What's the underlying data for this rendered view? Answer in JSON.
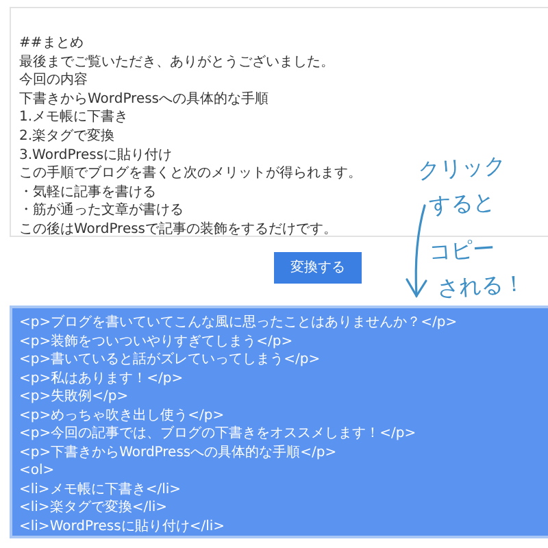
{
  "input": {
    "lines": [
      "##まとめ",
      "最後までご覧いただき、ありがとうございました。",
      "今回の内容",
      "下書きからWordPressへの具体的な手順",
      "1.メモ帳に下書き",
      "2.楽タグで変換",
      "3.WordPressに貼り付け",
      "この手順でブログを書くと次のメリットが得られます。",
      "・気軽に記事を書ける",
      "・筋が通った文章が書ける",
      "この後はWordPressで記事の装飾をするだけです。"
    ]
  },
  "convert_button": {
    "label": "変換する"
  },
  "output": {
    "selected": true,
    "lines": [
      "<p>ブログを書いていてこんな風に思ったことはありませんか？</p>",
      "<p>装飾をついついやりすぎてしまう</p>",
      "<p>書いていると話がズレていってしまう</p>",
      "<p>私はあります！</p>",
      "<p>失敗例</p>",
      "<p>めっちゃ吹き出し使う</p>",
      "<p>今回の記事では、ブログの下書きをオススメします！</p>",
      "<p>下書きからWordPressへの具体的な手順</p>",
      "<ol>",
      "<li>メモ帳に下書き</li>",
      "<li>楽タグで変換</li>",
      "<li>WordPressに貼り付け</li>"
    ]
  },
  "annotation": {
    "lines": [
      "クリック",
      "すると",
      "コピー",
      "される！"
    ]
  }
}
